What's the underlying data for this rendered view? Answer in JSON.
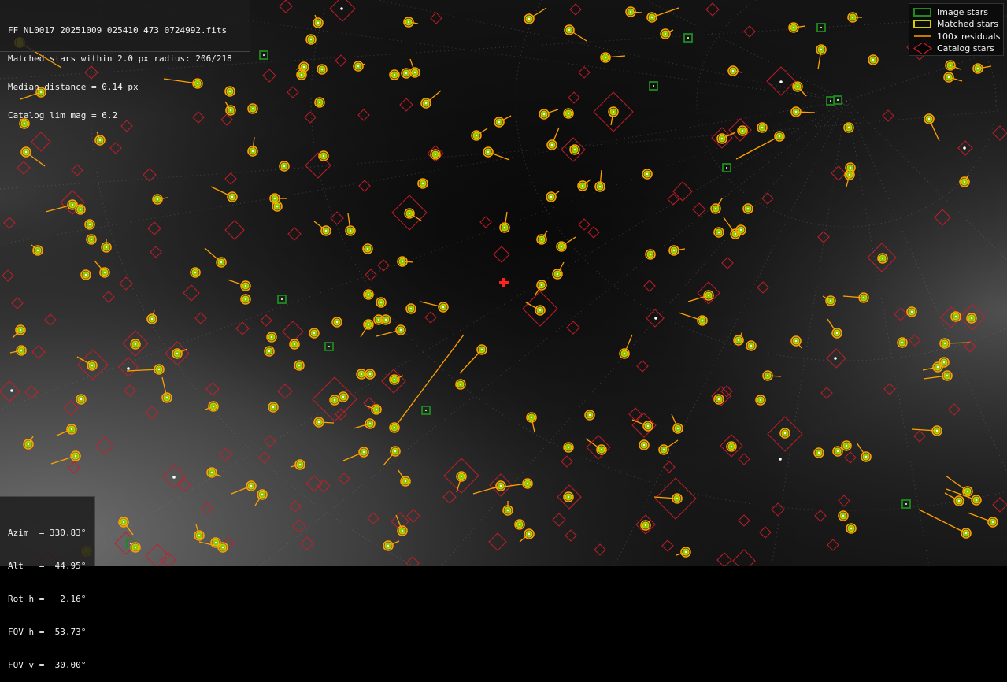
{
  "header": {
    "filename": "FF_NL0017_20251009_025410_473_0724992.fits",
    "matched": "Matched stars within 2.0 px radius: 206/218",
    "median": "Median distance = 0.14 px",
    "catalog": "Catalog lim mag = 6.2"
  },
  "legend": {
    "image_stars": "Image stars",
    "matched_stars": "Matched stars",
    "residuals": "100x residuals",
    "catalog_stars": "Catalog stars"
  },
  "pointing": {
    "azim": "Azim  = 330.83°",
    "alt": "Alt   =  44.95°",
    "rot": "Rot h =   2.16°",
    "fov_h": "FOV h =  53.73°",
    "fov_v": "FOV v =  30.00°"
  },
  "colors": {
    "image_star": "#1f8a1f",
    "matched_star_outer": "#d4d000",
    "matched_star_fill": "#8ac800",
    "residual": "#ffa000",
    "catalog_star": "#c81e2a",
    "center_marker": "#ff2020",
    "sky_glow": "#5a5a5a"
  },
  "icons": {
    "center": "red-cross-marker",
    "image_star": "green-square",
    "matched_star": "yellow-ring",
    "catalog_star": "red-diamond"
  }
}
